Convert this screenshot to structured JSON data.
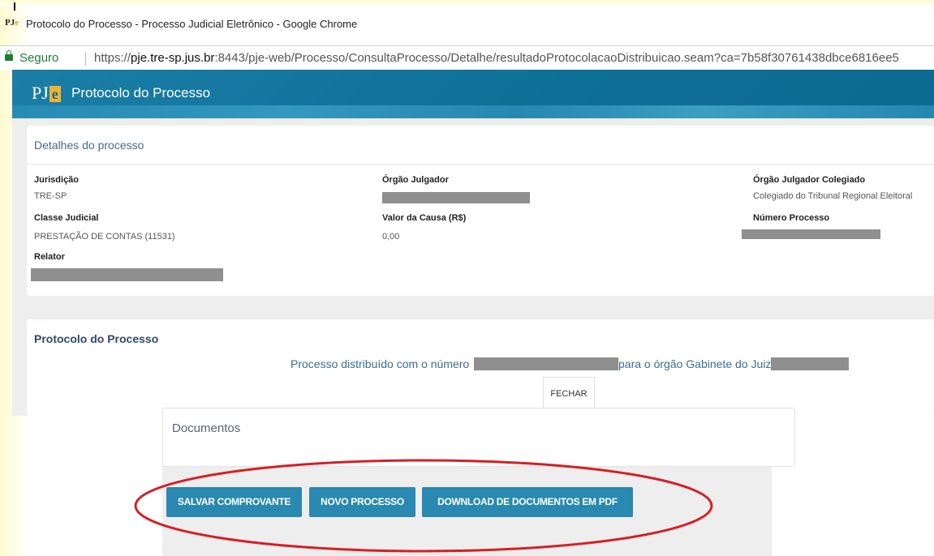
{
  "window": {
    "title": "Protocolo do Processo - Processo Judicial Eletrônico - Google Chrome",
    "logo_text": "PJe"
  },
  "address_bar": {
    "secure_label": "Seguro",
    "url_scheme": "https://",
    "url_host": "pje.tre-sp.jus.br",
    "url_rest": ":8443/pje-web/Processo/ConsultaProcesso/Detalhe/resultadoProtocolacaoDistribuicao.seam?ca=7b58f30761438dbce6816ee5"
  },
  "app": {
    "logo_p": "PJ",
    "logo_e": "e",
    "title": "Protocolo do Processo"
  },
  "details": {
    "heading": "Detalhes do processo",
    "jurisdicao_label": "Jurisdição",
    "jurisdicao_value": "TRE-SP",
    "orgao_label": "Órgão Julgador",
    "orgao_colegiado_label": "Órgão Julgador Colegiado",
    "orgao_colegiado_value": "Colegiado do Tribunal Regional Eleitoral",
    "classe_label": "Classe Judicial",
    "classe_value": "PRESTAÇÃO DE CONTAS (11531)",
    "valor_label": "Valor da Causa (R$)",
    "valor_value": "0,00",
    "numero_label": "Número Processo",
    "relator_label": "Relator"
  },
  "protocolo": {
    "heading": "Protocolo do Processo",
    "message_part1": "Processo distribuído com o número",
    "message_part2": "para o órgão Gabinete do Juiz",
    "close_button": "FECHAR"
  },
  "documentos": {
    "heading": "Documentos"
  },
  "actions": {
    "save_receipt": "SALVAR COMPROVANTE",
    "new_process": "NOVO PROCESSO",
    "download_pdf": "DOWNLOAD DE DOCUMENTOS EM PDF"
  },
  "colors": {
    "header_blue": "#0d6a90",
    "button_blue": "#2a89b0",
    "annotation_red": "#d61f26",
    "secure_green": "#1e7e34"
  }
}
